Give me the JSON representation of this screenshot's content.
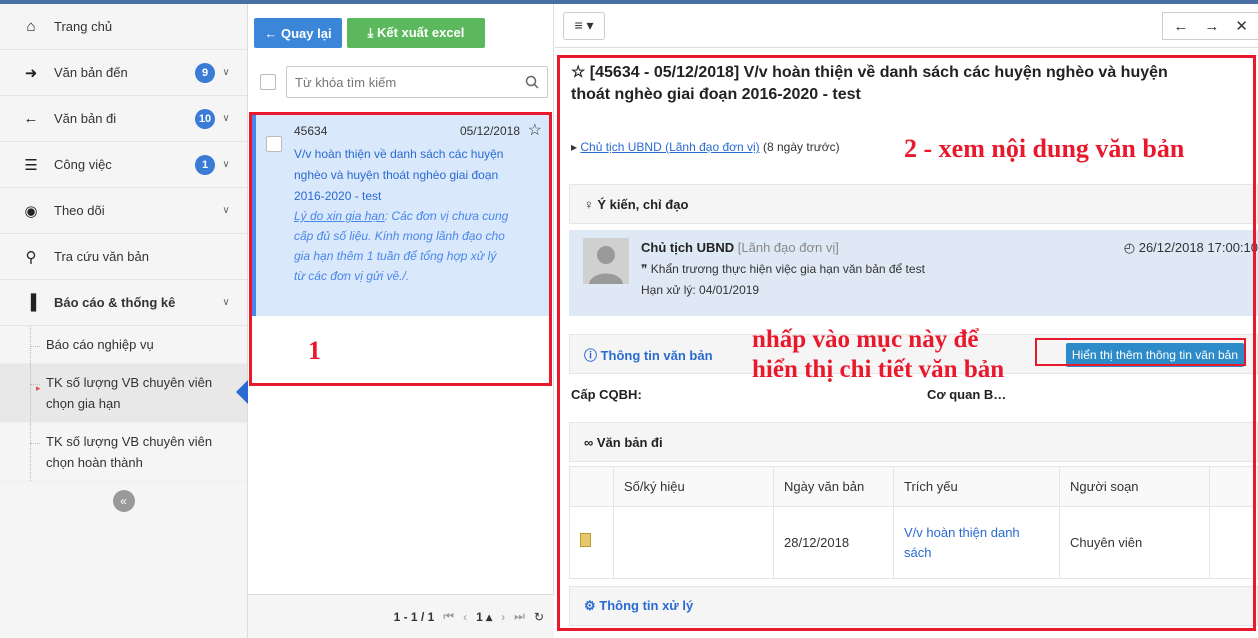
{
  "sidebar": {
    "items": [
      {
        "label": "Trang chủ",
        "icon": "home-icon",
        "glyph": "⌂",
        "badge": "",
        "chevron": ""
      },
      {
        "label": "Văn bản đến",
        "icon": "arrow-right-circle-icon",
        "glyph": "➜",
        "badge": "9",
        "chevron": "∨"
      },
      {
        "label": "Văn bản đi",
        "icon": "arrow-left-circle-icon",
        "glyph": "←",
        "badge": "10",
        "chevron": "∨"
      },
      {
        "label": "Công việc",
        "icon": "tasks-icon",
        "glyph": "☰",
        "badge": "1",
        "chevron": "∨"
      },
      {
        "label": "Theo dõi",
        "icon": "eye-icon",
        "glyph": "◉",
        "badge": "",
        "chevron": "∨"
      },
      {
        "label": "Tra cứu văn bản",
        "icon": "search-icon",
        "glyph": "⚲",
        "badge": "",
        "chevron": ""
      },
      {
        "label": "Báo cáo & thống kê",
        "icon": "bar-chart-icon",
        "glyph": "▐",
        "badge": "",
        "chevron": "∨"
      }
    ],
    "subitems": [
      {
        "label": "Báo cáo nghiệp vụ"
      },
      {
        "label": "TK số lượng VB chuyên viên chọn gia hạn"
      },
      {
        "label": "TK số lượng VB chuyên viên chọn hoàn thành"
      }
    ],
    "collapse_glyph": "«"
  },
  "middle": {
    "back_label": "← Quay lại",
    "export_label": "⤓ Kết xuất excel",
    "search_placeholder": "Từ khóa tìm kiếm",
    "item": {
      "number": "45634",
      "date": "05/12/2018",
      "title": "V/v hoàn thiện về danh sách các huyện nghèo và huyện thoát nghèo giai đoạn 2016-2020 - test",
      "reason_label": "Lý do xin gia hạn",
      "reason_text": ": Các đơn vị chưa cung cấp đủ số liệu. Kính mong lãnh đạo cho gia hạn thêm 1 tuần để tổng hợp xử lý từ các đơn vị gửi về./."
    },
    "pager": {
      "range": "1 - 1 / 1",
      "page": "1 ▴"
    }
  },
  "right": {
    "title_line1": "☆ [45634 - 05/12/2018] V/v hoàn thiện về danh sách các huyện nghèo và huyện",
    "title_line2": "thoát nghèo giai đoạn 2016-2020 - test",
    "sender_link": "Chủ tịch UBND (Lãnh đạo đơn vị)",
    "sender_ago": " (8 ngày trước)",
    "opinion_header": "♀ Ý kiến, chỉ đạo",
    "comment": {
      "author": "Chủ tịch UBND",
      "role": " [Lãnh đạo đơn vị]",
      "time": "◴ 26/12/2018 17:00:10",
      "text": "❞ Khẩn trương thực hiện việc gia hạn văn bản để test",
      "due": "Hạn xử lý: 04/01/2019"
    },
    "info_header": "ⓘ Thông tin văn bản",
    "info_button": "Hiển thị thêm thông tin văn bản",
    "cq_label": "Cấp CQBH:",
    "cq_value": "Cơ quan B…",
    "outgoing_header": "∞ Văn bản đi",
    "table": {
      "headers": [
        "",
        "Số/ký hiệu",
        "Ngày văn bản",
        "Trích yếu",
        "Người soạn",
        ""
      ],
      "row": {
        "symbol": "",
        "date": "28/12/2018",
        "summary": "V/v hoàn thiện danh sách",
        "author": "Chuyên viên"
      }
    },
    "process_header": "⚙ Thông tin xử lý"
  },
  "annotations": {
    "label1": "1",
    "label2": "2 - xem nội dung văn bản",
    "note": "nhấp vào mục này để hiển thị chi tiết văn bản"
  },
  "colors": {
    "primary": "#337ab7",
    "success": "#5cb85c",
    "annotation": "#e8192c"
  }
}
